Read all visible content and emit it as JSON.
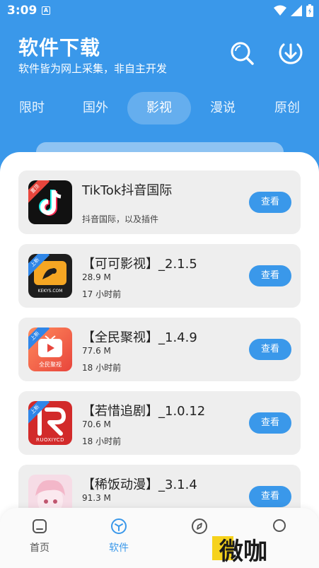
{
  "status_bar": {
    "time": "3:09",
    "notif_icon": "A"
  },
  "header": {
    "title": "软件下载",
    "subtitle": "软件皆为网上采集，非自主开发",
    "search_icon": "search-icon",
    "download_icon": "download-icon"
  },
  "tabs": [
    {
      "label": "限时",
      "active": false
    },
    {
      "label": "国外",
      "active": false
    },
    {
      "label": "影视",
      "active": true
    },
    {
      "label": "漫说",
      "active": false
    },
    {
      "label": "原创",
      "active": false
    }
  ],
  "apps": [
    {
      "name": "TikTok抖音国际",
      "description": "抖音国际，以及插件",
      "badge": "置顶",
      "button": "查看",
      "icon_label": ""
    },
    {
      "name": "【可可影视】_2.1.5",
      "size": "28.9 M",
      "time": "17 小时前",
      "badge": "上新",
      "button": "查看",
      "icon_label": "KEKYS.COM"
    },
    {
      "name": "【全民聚视】_1.4.9",
      "size": "77.6 M",
      "time": "18 小时前",
      "badge": "上新",
      "button": "查看",
      "icon_label": "全民聚视"
    },
    {
      "name": "【若惜追剧】_1.0.12",
      "size": "70.6 M",
      "time": "18 小时前",
      "badge": "上新",
      "button": "查看",
      "icon_label": "RUOXIYCD"
    },
    {
      "name": "【稀饭动漫】_3.1.4",
      "size": "91.3 M",
      "time": "",
      "badge": "",
      "button": "查看",
      "icon_label": ""
    }
  ],
  "bottom_nav": [
    {
      "label": "首页",
      "icon": "home-icon",
      "active": false
    },
    {
      "label": "软件",
      "icon": "cube-icon",
      "active": true
    },
    {
      "label": "",
      "icon": "compass-icon",
      "active": false
    },
    {
      "label": "",
      "icon": "profile-icon",
      "active": false
    }
  ],
  "watermark": "微咖",
  "colors": {
    "primary": "#3a98ea",
    "badge_red": "#e8453c"
  }
}
